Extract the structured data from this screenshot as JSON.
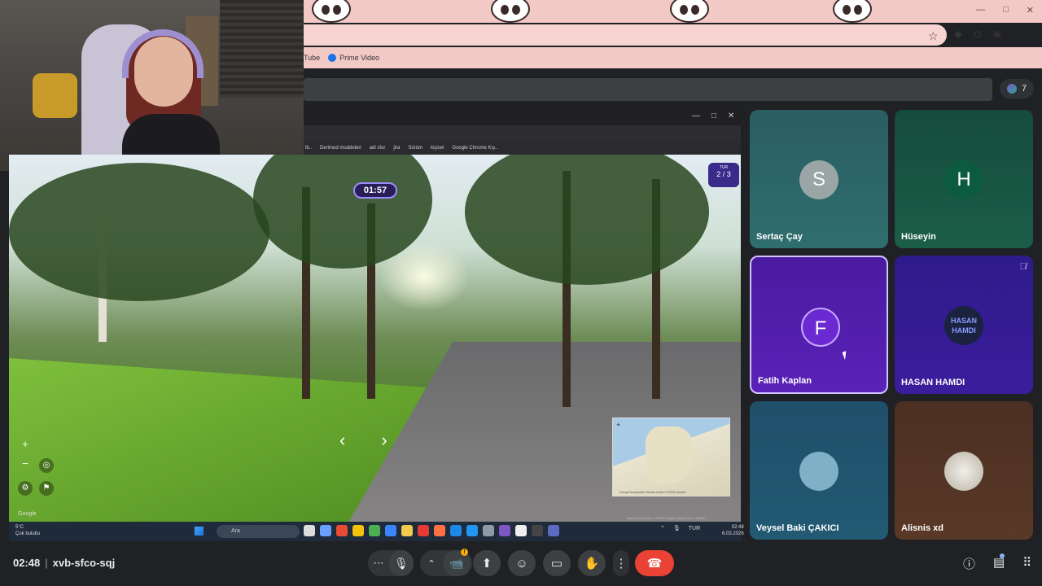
{
  "browser": {
    "bookmarks": [
      {
        "label": "Tube",
        "icon": "youtube-icon"
      },
      {
        "label": "Prime Video",
        "icon": "prime-video-icon"
      }
    ],
    "window_controls": [
      "—",
      "□",
      "✕"
    ]
  },
  "meet": {
    "people_count": "7",
    "meeting_time": "02:48",
    "meeting_code": "xvb-sfco-sqj",
    "controls": [
      "more-options",
      "microphone",
      "caret-up",
      "camera",
      "present",
      "emoji",
      "captions",
      "raise-hand",
      "more",
      "leave-call"
    ],
    "right_controls": [
      "meeting-info",
      "chat",
      "activities"
    ]
  },
  "shared_screen": {
    "bookmarks": [
      "lb..",
      "Derimod muddeleri",
      "adl sfor",
      "jira",
      "Sürüm",
      "kişisel",
      "Google Chrome Kış.."
    ],
    "timer": "01:57",
    "round_small": "TUR",
    "round": "2 / 3",
    "google_mark": "Google",
    "map_credits": "Klavye kısayolları  Harita verileri ©2026  Şartlar",
    "footer_credits": "Klavye kısayolları  © 2026 Google  Şartlar  Sorun bildirin",
    "taskbar": {
      "weather_temp": "5°C",
      "weather_desc": "Çok bulutlu",
      "search_placeholder": "Ara",
      "lang": "TUR",
      "clock_time": "02:48",
      "clock_date": "6.03.2026"
    }
  },
  "participants": [
    {
      "name": "Sertaç Çay",
      "initial": "S"
    },
    {
      "name": "Hüseyin",
      "initial": "H"
    },
    {
      "name": "Fatih Kaplan",
      "initial": "F"
    },
    {
      "name": "HASAN HAMDI",
      "initial": "HASAN HAMDI",
      "muted": true
    },
    {
      "name": "Veysel Baki ÇAKICI",
      "initial": ""
    },
    {
      "name": "Alisnis xd",
      "initial": ""
    }
  ],
  "colors": {
    "accent_purple": "#6b2ad1",
    "hangup_red": "#ea4335",
    "warning_yellow": "#f9ab00",
    "chrome_pink": "#f3c9c6"
  }
}
